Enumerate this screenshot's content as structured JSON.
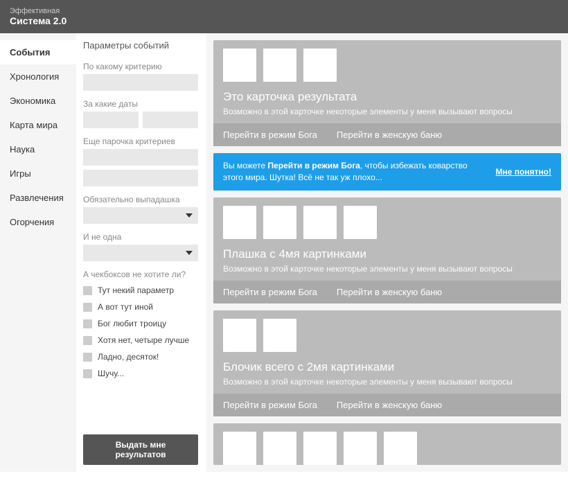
{
  "header": {
    "subtitle": "Эффективная",
    "title": "Система 2.0"
  },
  "sidebar": {
    "items": [
      "События",
      "Хронология",
      "Экономика",
      "Карта мира",
      "Наука",
      "Игры",
      "Развлечения",
      "Огорчения"
    ],
    "active_index": 0
  },
  "params": {
    "title": "Параметры событий",
    "criterion_label": "По какому критерию",
    "dates_label": "За какие даты",
    "more_criteria_label": "Еще парочка критериев",
    "dropdown1_label": "Обязательно выпадашка",
    "dropdown2_label": "И не одна",
    "checkbox_group_label": "А чекбоксов не хотите ли?",
    "checkboxes": [
      "Тут некий параметр",
      "А вот тут иной",
      "Бог любит троицу",
      "Хотя нет, четыре лучше",
      "Ладно, десяток!",
      "Шучу..."
    ],
    "submit_label": "Выдать мне результатов"
  },
  "alert": {
    "prefix": "Вы можете ",
    "bold": "Перейти в режим Бога",
    "suffix": ", чтобы избежать коварство этого мира. Шутка! Всё не так уж плохо...",
    "dismiss": "Мне понятно!"
  },
  "cards": [
    {
      "thumbs": 3,
      "title": "Это карточка результата",
      "desc": "Возможно в этой карточке некоторые элементы у меня вызывают вопросы",
      "action1": "Перейти в режим Бога",
      "action2": "Перейти в женскую баню"
    },
    {
      "thumbs": 4,
      "title": "Плашка с 4мя картинками",
      "desc": "Возможно в этой карточке некоторые элементы у меня вызывают вопросы",
      "action1": "Перейти в режим Бога",
      "action2": "Перейти в женскую баню"
    },
    {
      "thumbs": 2,
      "title": "Блочик всего с 2мя картинками",
      "desc": "Возможно в этой карточке некоторые элементы у меня вызывают вопросы",
      "action1": "Перейти в режим Бога",
      "action2": "Перейти в женскую баню"
    }
  ],
  "bottom_thumbs": 5
}
